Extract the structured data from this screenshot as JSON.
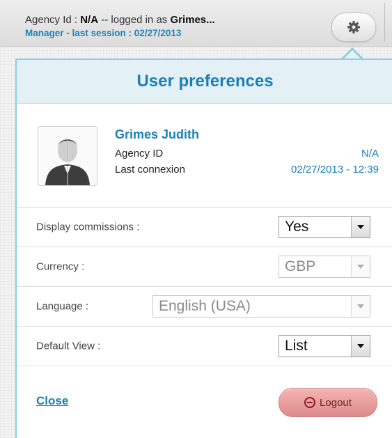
{
  "header": {
    "agency_prefix": "Agency Id : ",
    "agency_id": "N/A",
    "logged_in_text": " -- logged in as ",
    "user_short": "Grimes...",
    "session_line": "Manager - last session : 02/27/2013",
    "settings_icon": "gear-icon"
  },
  "panel": {
    "title": "User preferences",
    "user": {
      "name": "Grimes Judith",
      "agency_label": "Agency ID",
      "agency_value": "N/A",
      "last_label": "Last connexion",
      "last_value": "02/27/2013 - 12:39",
      "avatar_icon": "user-avatar-icon"
    },
    "prefs": {
      "commissions_label": "Display commissions :",
      "commissions_value": "Yes",
      "currency_label": "Currency :",
      "currency_value": "GBP",
      "language_label": "Language :",
      "language_value": "English (USA)",
      "view_label": "Default View :",
      "view_value": "List"
    },
    "footer": {
      "close_label": "Close",
      "logout_label": "Logout"
    }
  },
  "colors": {
    "accent": "#1b7fb7",
    "panel_border": "#8ccde6",
    "logout": "#e49a9a"
  }
}
